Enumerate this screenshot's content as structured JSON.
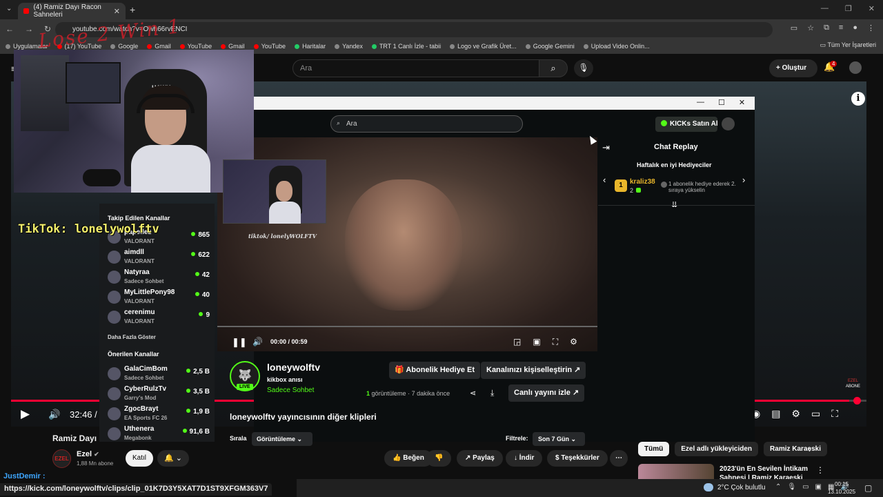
{
  "browser": {
    "tab_title": "(4) Ramiz Dayı Racon Sahneleri",
    "url": "youtube.com/watch?v=Owh66rvENCI",
    "bookmarks": [
      "Uygulamalar",
      "(17) YouTube",
      "Google",
      "Gmail",
      "YouTube",
      "Gmail",
      "YouTube",
      "Haritalar",
      "Yandex",
      "TRT 1 Canlı İzle - tabii",
      "Logo ve Grafik Üret...",
      "Google Gemini",
      "Upload Video Onlin..."
    ],
    "bookmarks_right": "Tüm Yer İşaretleri",
    "status_url": "https://kick.com/loneywolftv/clips/clip_01K7D3Y5XAT7D1ST9XFGM363V7"
  },
  "youtube": {
    "search_placeholder": "Ara",
    "create_label": "Oluştur",
    "notification_count": "4",
    "time": "32:46 /",
    "title": "Ramiz Dayı",
    "channel_logo": "EZEL",
    "channel_name": "Ezel",
    "subscribers": "1,88 Mn abone",
    "join_label": "Katıl",
    "like_label": "Beğen",
    "share_label": "Paylaş",
    "download_label": "İndir",
    "thanks_label": "Teşekkürler",
    "abone_label": "ABONE",
    "chips": [
      "Tümü",
      "Ezel adlı yükleyiciden",
      "Ramiz Karaeski"
    ],
    "rec_title": "2023'ün En Sevilen İntikam Sahnesi | Ramiz Karaeski",
    "progress_fraction": 0.98
  },
  "overlay": {
    "handwriting": "Lose 2 Win 1",
    "tiktok": "TikTok: lonelywolftv",
    "chair_logo": "HAWK",
    "viewer_name": "JustDemir :"
  },
  "kick": {
    "search_placeholder": "Ara",
    "ai_button": "KICKs Satın Al",
    "video_time": "00:00 / 00:59",
    "watermark": "tiktok/ lonelyWOLFTV",
    "chat_title": "Chat Replay",
    "weekly_title": "Haftalık en iyi Hediyeciler",
    "top_gifter": "kraliz38",
    "top_gifter_count": "2",
    "gift_hint": "1 abonelik hediye ederek 2. sıraya yükselin",
    "channel_name": "loneywolftv",
    "clip_title": "kikbox anısı",
    "category": "Sadece Sohbet",
    "live_badge": "LIVE",
    "gift_sub_button": "Abonelik Hediye Et",
    "customize_button": "Kanalınızı kişiselleştirin",
    "watch_live_button": "Canlı yayını izle",
    "views_count": "1",
    "views_text": "görüntüleme",
    "views_age": "· 7 dakika önce",
    "clips_title": "loneywolftv yayıncısının diğer klipleri",
    "sort_label": "Sırala",
    "sort_value": "Görüntüleme",
    "filter_label": "Filtrele:",
    "filter_value": "Son 7 Gün",
    "followed_title": "Takip Edilen Kanallar",
    "followed": [
      {
        "name": "papellez",
        "game": "VALORANT",
        "count": "865"
      },
      {
        "name": "aimdll",
        "game": "VALORANT",
        "count": "622"
      },
      {
        "name": "Natyraa",
        "game": "Sadece Sohbet",
        "count": "42"
      },
      {
        "name": "MyLittlePony98",
        "game": "VALORANT",
        "count": "40"
      },
      {
        "name": "cerenimu",
        "game": "VALORANT",
        "count": "9"
      }
    ],
    "show_more": "Daha Fazla Göster",
    "recommended_title": "Önerilen Kanallar",
    "recommended": [
      {
        "name": "GalaCimBom",
        "game": "Sadece Sohbet",
        "count": "2,5 B"
      },
      {
        "name": "CyberRulzTv",
        "game": "Garry's Mod",
        "count": "3,5 B"
      },
      {
        "name": "ZgocBrayt",
        "game": "EA Sports FC 26",
        "count": "1,9 B"
      },
      {
        "name": "Uthenera",
        "game": "Megabonk",
        "count": "91,6 B"
      }
    ]
  },
  "taskbar": {
    "weather": "2°C  Çok bulutlu",
    "time": "00:15",
    "date": "13.10.2025"
  }
}
